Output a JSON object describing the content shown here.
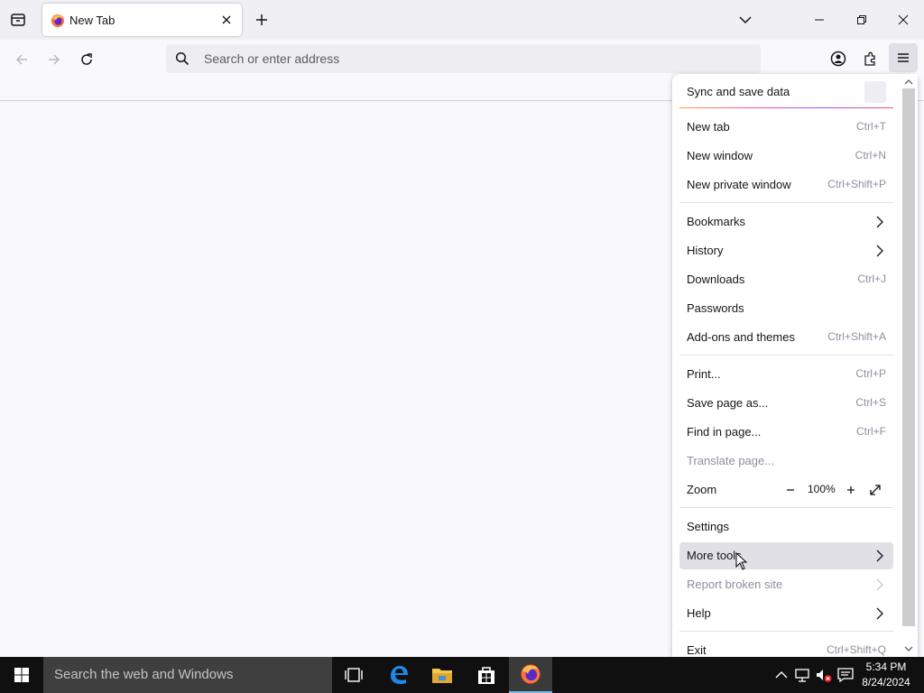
{
  "tabs": [
    {
      "title": "New Tab"
    }
  ],
  "urlbar": {
    "placeholder": "Search or enter address"
  },
  "app_menu": {
    "sync_label": "Sync and save data",
    "items": [
      {
        "label": "New tab",
        "shortcut": "Ctrl+T"
      },
      {
        "label": "New window",
        "shortcut": "Ctrl+N"
      },
      {
        "label": "New private window",
        "shortcut": "Ctrl+Shift+P"
      },
      {
        "label": "Bookmarks"
      },
      {
        "label": "History"
      },
      {
        "label": "Downloads",
        "shortcut": "Ctrl+J"
      },
      {
        "label": "Passwords"
      },
      {
        "label": "Add-ons and themes",
        "shortcut": "Ctrl+Shift+A"
      },
      {
        "label": "Print...",
        "shortcut": "Ctrl+P"
      },
      {
        "label": "Save page as...",
        "shortcut": "Ctrl+S"
      },
      {
        "label": "Find in page...",
        "shortcut": "Ctrl+F"
      },
      {
        "label": "Translate page...",
        "disabled": true
      },
      {
        "label": "Zoom",
        "zoom_value": "100%"
      },
      {
        "label": "Settings"
      },
      {
        "label": "More tools",
        "hovered": true
      },
      {
        "label": "Report broken site",
        "disabled": true
      },
      {
        "label": "Help"
      },
      {
        "label": "Exit",
        "shortcut": "Ctrl+Shift+Q"
      }
    ]
  },
  "taskbar": {
    "search_placeholder": "Search the web and Windows",
    "clock_time": "5:34 PM",
    "clock_date": "8/24/2024"
  },
  "colors": {
    "accent": "#0061e0",
    "taskbar": "#101010",
    "menu_hover": "#e0e0e6"
  },
  "icons": [
    "firefox-view-icon",
    "firefox-icon",
    "close-icon",
    "plus-icon",
    "chevron-down-icon",
    "minimize-icon",
    "maximize-icon",
    "back-icon",
    "forward-icon",
    "reload-icon",
    "search-icon",
    "account-icon",
    "extensions-icon",
    "hamburger-icon",
    "chevron-right-icon",
    "zoom-out-icon",
    "zoom-in-icon",
    "fullscreen-icon",
    "windows-logo-icon",
    "task-view-icon",
    "edge-icon",
    "file-explorer-icon",
    "store-icon",
    "network-icon",
    "volume-muted-icon",
    "action-center-icon",
    "up-arrow-icon"
  ]
}
